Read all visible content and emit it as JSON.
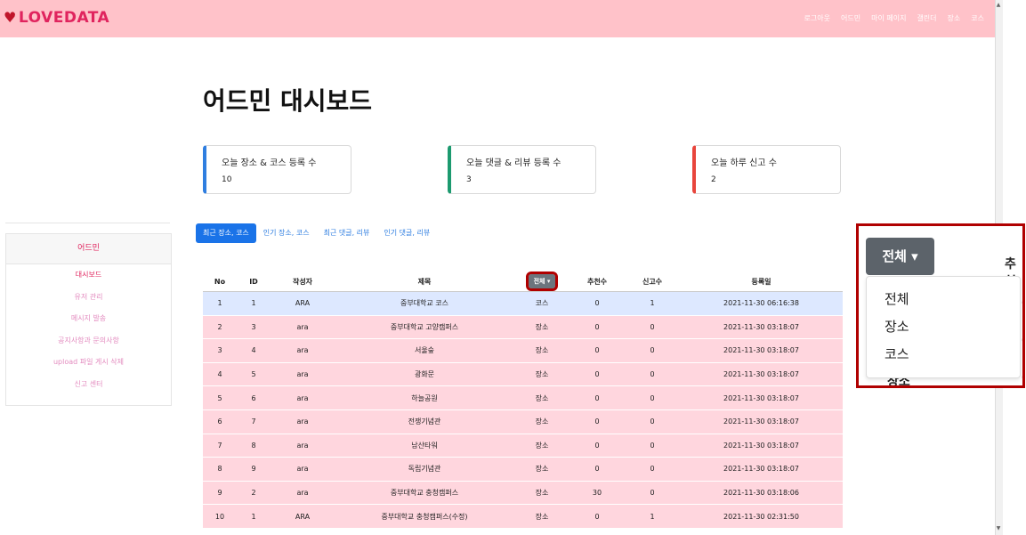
{
  "brand": {
    "name": "LOVEDATA",
    "icon": "heart-icon"
  },
  "nav": [
    "로그아웃",
    "어드민",
    "마이 페이지",
    "갤린더",
    "장소",
    "코스"
  ],
  "page_title": "어드민 대시보드",
  "cards": [
    {
      "label": "오늘 장소 & 코스 등록 수",
      "value": "10",
      "accent": "#2f7ee0"
    },
    {
      "label": "오늘 댓글 & 리뷰 등록 수",
      "value": "3",
      "accent": "#1c9a6f"
    },
    {
      "label": "오늘 하루 신고 수",
      "value": "2",
      "accent": "#e8453c"
    }
  ],
  "sidebar": {
    "header": "어드민",
    "items": [
      "대시보드",
      "유저 관리",
      "메시지 발송",
      "공지사항과 문의사항",
      "upload 파일 게시 삭제",
      "신고 센터"
    ]
  },
  "tabs": [
    "최근 장소, 코스",
    "인기 장소, 코스",
    "최근 댓글, 리뷰",
    "인기 댓글, 리뷰"
  ],
  "table": {
    "headers": [
      "No",
      "ID",
      "작성자",
      "제목",
      "전체",
      "추천수",
      "신고수",
      "등록일"
    ],
    "filter_label": "전체",
    "rows": [
      {
        "no": "1",
        "id": "1",
        "author": "ARA",
        "title": "중부대학교 코스",
        "type": "코스",
        "rec": "0",
        "rep": "1",
        "date": "2021-11-30 06:16:38"
      },
      {
        "no": "2",
        "id": "3",
        "author": "ara",
        "title": "중부대학교 고양캠퍼스",
        "type": "장소",
        "rec": "0",
        "rep": "0",
        "date": "2021-11-30 03:18:07"
      },
      {
        "no": "3",
        "id": "4",
        "author": "ara",
        "title": "서울숲",
        "type": "장소",
        "rec": "0",
        "rep": "0",
        "date": "2021-11-30 03:18:07"
      },
      {
        "no": "4",
        "id": "5",
        "author": "ara",
        "title": "광화문",
        "type": "장소",
        "rec": "0",
        "rep": "0",
        "date": "2021-11-30 03:18:07"
      },
      {
        "no": "5",
        "id": "6",
        "author": "ara",
        "title": "하늘공원",
        "type": "장소",
        "rec": "0",
        "rep": "0",
        "date": "2021-11-30 03:18:07"
      },
      {
        "no": "6",
        "id": "7",
        "author": "ara",
        "title": "전쟁기념관",
        "type": "장소",
        "rec": "0",
        "rep": "0",
        "date": "2021-11-30 03:18:07"
      },
      {
        "no": "7",
        "id": "8",
        "author": "ara",
        "title": "남산타워",
        "type": "장소",
        "rec": "0",
        "rep": "0",
        "date": "2021-11-30 03:18:07"
      },
      {
        "no": "8",
        "id": "9",
        "author": "ara",
        "title": "독립기념관",
        "type": "장소",
        "rec": "0",
        "rep": "0",
        "date": "2021-11-30 03:18:07"
      },
      {
        "no": "9",
        "id": "2",
        "author": "ara",
        "title": "중부대학교 충청캠퍼스",
        "type": "장소",
        "rec": "30",
        "rep": "0",
        "date": "2021-11-30 03:18:06"
      },
      {
        "no": "10",
        "id": "1",
        "author": "ARA",
        "title": "중부대학교 충청캠퍼스(수정)",
        "type": "장소",
        "rec": "0",
        "rep": "1",
        "date": "2021-11-30 02:31:50"
      }
    ]
  },
  "zoom": {
    "button": "전체",
    "header_partial": "추천",
    "options": [
      "전체",
      "장소",
      "코스"
    ],
    "behind_text": "장소",
    "sliver": [
      "0",
      "0",
      "0"
    ]
  }
}
